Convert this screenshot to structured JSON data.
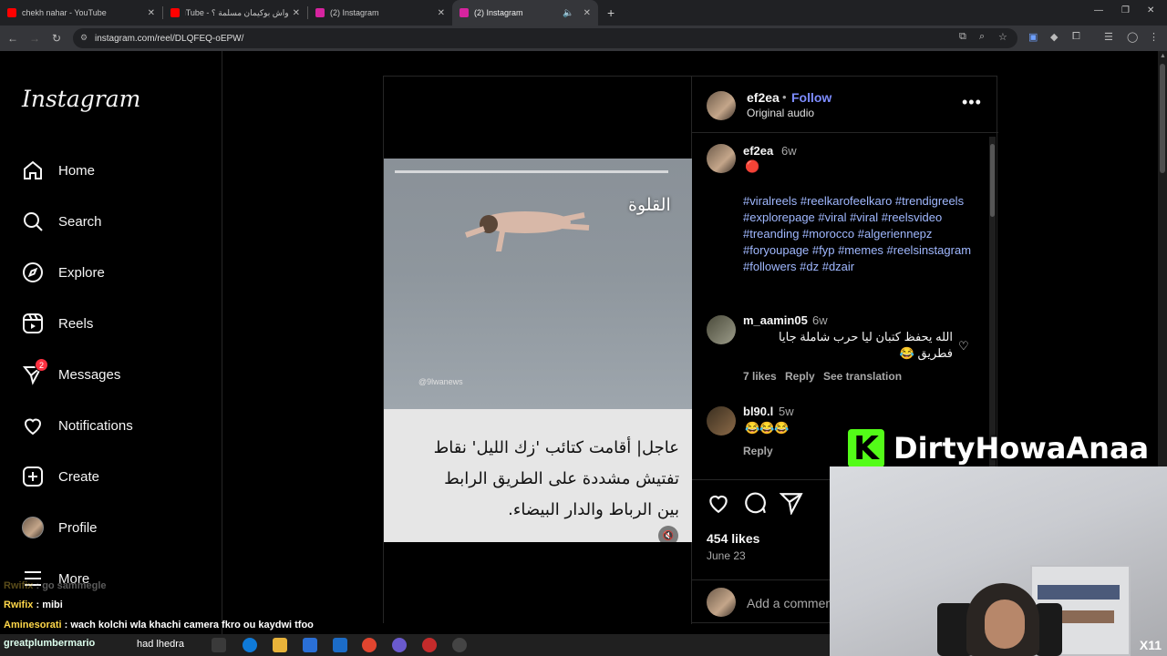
{
  "browser": {
    "tabs": [
      {
        "title": "chekh nahar - YouTube",
        "icon": "youtube-icon",
        "color": "#ff0000"
      },
      {
        "title": "واش بوكيمان مسلمة ؟ - YouTube",
        "icon": "youtube-icon",
        "color": "#ff0000"
      },
      {
        "title": "(2) Instagram",
        "icon": "instagram-icon",
        "color": "#d6249f"
      },
      {
        "title": "(2) Instagram",
        "icon": "instagram-icon",
        "color": "#d6249f"
      }
    ],
    "new_tab": "+",
    "url": "instagram.com/reel/DLQFEQ-oEPW/"
  },
  "instagram": {
    "logo": "Instagram",
    "nav": [
      {
        "label": "Home",
        "icon": "home-icon"
      },
      {
        "label": "Search",
        "icon": "search-icon"
      },
      {
        "label": "Explore",
        "icon": "compass-icon"
      },
      {
        "label": "Reels",
        "icon": "reels-icon"
      },
      {
        "label": "Messages",
        "icon": "messenger-icon",
        "badge": "2"
      },
      {
        "label": "Notifications",
        "icon": "heart-icon"
      },
      {
        "label": "Create",
        "icon": "plus-square-icon"
      },
      {
        "label": "Profile",
        "icon": "avatar"
      },
      {
        "label": "More",
        "icon": "menu-icon"
      }
    ]
  },
  "post": {
    "video": {
      "label": "القلوة",
      "watermark": "@9lwanews",
      "caption_lines": [
        "عاجل| أقامت كتائب 'زك الليل' نقاط",
        "تفتيش مشددة على الطريق الرابط",
        "بين الرباط والدار البيضاء."
      ]
    },
    "header": {
      "username": "ef2ea",
      "dot": "•",
      "follow": "Follow",
      "audio": "Original audio",
      "more": "•••"
    },
    "caption": {
      "username": "ef2ea",
      "time": "6w",
      "emoji": "🔴",
      "hashtags": "#viralreels #reelkarofeelkaro #trendigreels #explorepage #viral #viral #reelsvideo #treanding #morocco #algeriennepz #foryoupage #fyp #memes #reelsinstagram #followers #dz #dzair"
    },
    "comments": [
      {
        "username": "m_aamin05",
        "time": "6w",
        "text_line1": "الله يحفظ كتبان ليا حرب شاملة جايا",
        "text_line2": "فطريق 😂",
        "likes": "7 likes",
        "reply": "Reply",
        "translate": "See translation"
      },
      {
        "username": "bl90.l",
        "time": "5w",
        "text_line1": "😂😂😂",
        "reply": "Reply"
      }
    ],
    "likes": "454 likes",
    "date": "June 23",
    "add_comment_placeholder": "Add a comment..."
  },
  "overlay": {
    "brand_letter": "K",
    "brand_name": "DirtyHowaAnaa",
    "brand_color": "#53fc18",
    "cam_corner": "X11"
  },
  "chat": [
    {
      "user": "Rwifix",
      "msg": "go sammegle",
      "faded": true
    },
    {
      "user": "Rwifix",
      "msg": "mibi",
      "faded": false
    },
    {
      "user": "Aminesorati",
      "msg": "wach kolchi wla khachi camera fkro ou kaydwi tfoo",
      "faded": false
    }
  ],
  "taskbar": {
    "user1": "greatplumbermario",
    "user2": "had lhedra"
  }
}
